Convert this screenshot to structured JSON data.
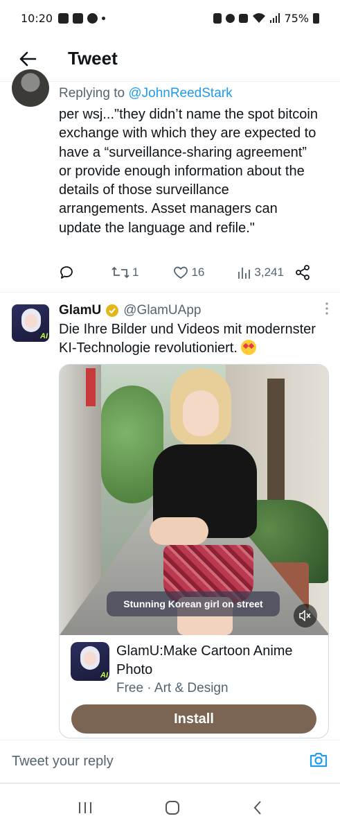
{
  "status_bar": {
    "time": "10:20",
    "battery": "75%"
  },
  "header": {
    "title": "Tweet"
  },
  "tweet1": {
    "replying_prefix": "Replying to ",
    "replying_to": "@JohnReedStark",
    "text": "per wsj...\"they didn’t name the spot bitcoin exchange with which they are expected to have a “surveillance-sharing agreement” or provide enough information about the details of those surveillance arrangements. Asset managers can update the language and refile.\"",
    "retweets": "1",
    "likes": "16",
    "views": "3,241"
  },
  "tweet2": {
    "name": "GlamU",
    "handle": "@GlamUApp",
    "text": "Die Ihre Bilder und Videos mit modernster KI-Technologie revolutioniert.",
    "emoji": "star-struck-emoji",
    "media_caption": "Stunning Korean girl on street",
    "app_name": "GlamU:Make Cartoon Anime Photo",
    "app_sub": "Free · Art & Design",
    "install_label": "Install",
    "ai_tag": "AI"
  },
  "reply": {
    "placeholder": "Tweet your reply"
  },
  "colors": {
    "accent": "#1d9bf0",
    "muted": "#536471",
    "install_bg": "#7b6552",
    "verified": "#e2b719"
  }
}
